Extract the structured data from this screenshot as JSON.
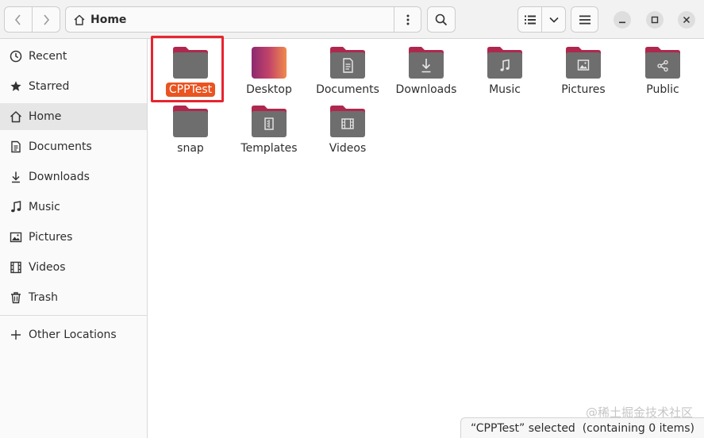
{
  "header": {
    "location": "Home"
  },
  "sidebar": {
    "items": [
      {
        "label": "Recent",
        "icon": "clock-icon"
      },
      {
        "label": "Starred",
        "icon": "star-icon"
      },
      {
        "label": "Home",
        "icon": "home-icon",
        "active": true
      },
      {
        "label": "Documents",
        "icon": "document-icon"
      },
      {
        "label": "Downloads",
        "icon": "download-icon"
      },
      {
        "label": "Music",
        "icon": "music-icon"
      },
      {
        "label": "Pictures",
        "icon": "picture-icon"
      },
      {
        "label": "Videos",
        "icon": "video-icon"
      },
      {
        "label": "Trash",
        "icon": "trash-icon"
      }
    ],
    "other_locations": "Other Locations"
  },
  "files": [
    {
      "name": "CPPTest",
      "emblem": "none",
      "selected": true
    },
    {
      "name": "Desktop",
      "emblem": "desktop"
    },
    {
      "name": "Documents",
      "emblem": "document"
    },
    {
      "name": "Downloads",
      "emblem": "download"
    },
    {
      "name": "Music",
      "emblem": "music"
    },
    {
      "name": "Pictures",
      "emblem": "picture"
    },
    {
      "name": "Public",
      "emblem": "share"
    },
    {
      "name": "snap",
      "emblem": "none"
    },
    {
      "name": "Templates",
      "emblem": "template"
    },
    {
      "name": "Videos",
      "emblem": "video"
    }
  ],
  "status": "“CPPTest” selected  (containing 0 items)",
  "watermark": "@稀土掘金技术社区",
  "colors": {
    "accent": "#e95420",
    "folder_body": "#6e6e6e",
    "folder_tab": "#b0274d",
    "highlight_box": "#e8242e"
  }
}
